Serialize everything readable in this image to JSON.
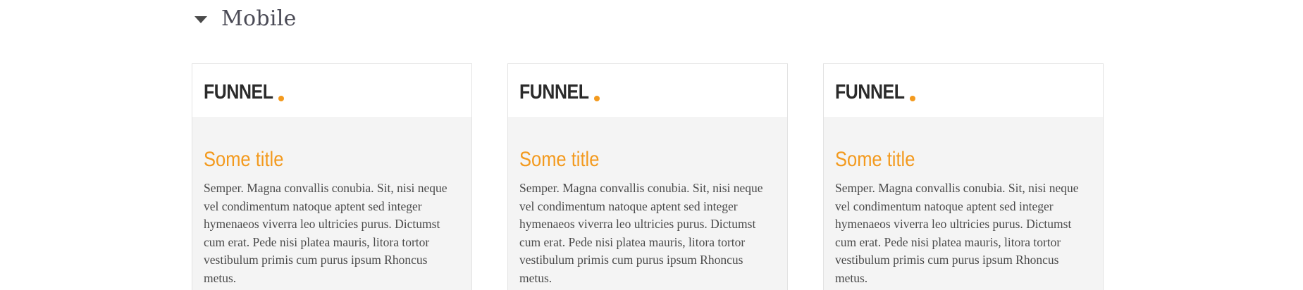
{
  "section": {
    "title": "Mobile",
    "toggle_icon": "caret-down-icon"
  },
  "cards": [
    {
      "logo_text": "FUNNEL",
      "title": "Some title",
      "body": "Semper. Magna convallis conubia. Sit, nisi neque vel condimentum natoque aptent sed integer hymenaeos viverra leo ultricies purus. Dictumst cum erat. Pede nisi platea mauris, litora tortor vestibulum primis cum purus ipsum Rhoncus metus."
    },
    {
      "logo_text": "FUNNEL",
      "title": "Some title",
      "body": "Semper. Magna convallis conubia. Sit, nisi neque vel condimentum natoque aptent sed integer hymenaeos viverra leo ultricies purus. Dictumst cum erat. Pede nisi platea mauris, litora tortor vestibulum primis cum purus ipsum Rhoncus metus."
    },
    {
      "logo_text": "FUNNEL",
      "title": "Some title",
      "body": "Semper. Magna convallis conubia. Sit, nisi neque vel condimentum natoque aptent sed integer hymenaeos viverra leo ultricies purus. Dictumst cum erat. Pede nisi platea mauris, litora tortor vestibulum primis cum purus ipsum Rhoncus metus."
    }
  ],
  "colors": {
    "accent": "#f39a1e",
    "card_body_bg": "#f4f4f4",
    "logo_text": "#2a2a2a"
  }
}
